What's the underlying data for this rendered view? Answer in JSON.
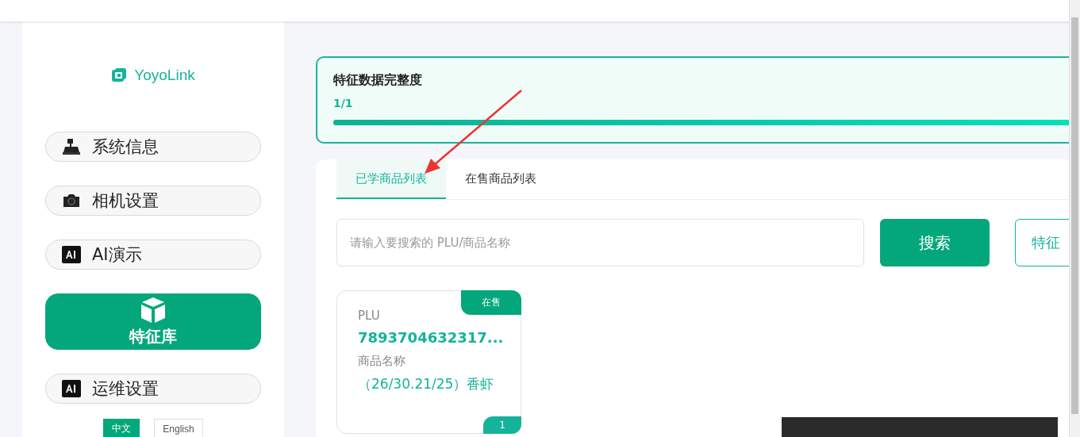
{
  "sidebar": {
    "logo": "YoyoLink",
    "items": [
      {
        "label": "系统信息",
        "kind": "register",
        "selected": false
      },
      {
        "label": "相机设置",
        "kind": "camera",
        "selected": false
      },
      {
        "label": "AI演示",
        "kind": "ai",
        "selected": false
      },
      {
        "label": "特征库",
        "kind": "cube",
        "selected": true
      },
      {
        "label": "运维设置",
        "kind": "ai",
        "selected": false
      }
    ],
    "languages": [
      {
        "label": "中文",
        "selected": true
      },
      {
        "label": "English",
        "selected": false
      }
    ]
  },
  "completeness": {
    "title": "特征数据完整度",
    "reading": "1/1",
    "level": 1
  },
  "tabs": [
    {
      "label": "已学商品列表",
      "selected": true
    },
    {
      "label": "在售商品列表",
      "selected": false
    }
  ],
  "search": {
    "placeholder": "请输入要搜索的 PLU/商品名称",
    "button": "搜索",
    "extra_button": "特征"
  },
  "products": [
    {
      "status": "在售",
      "plu_label": "PLU",
      "plu": "7893704632317...",
      "name_label": "商品名称",
      "name": "（26/30.21/25）香虾",
      "count": "1"
    }
  ]
}
